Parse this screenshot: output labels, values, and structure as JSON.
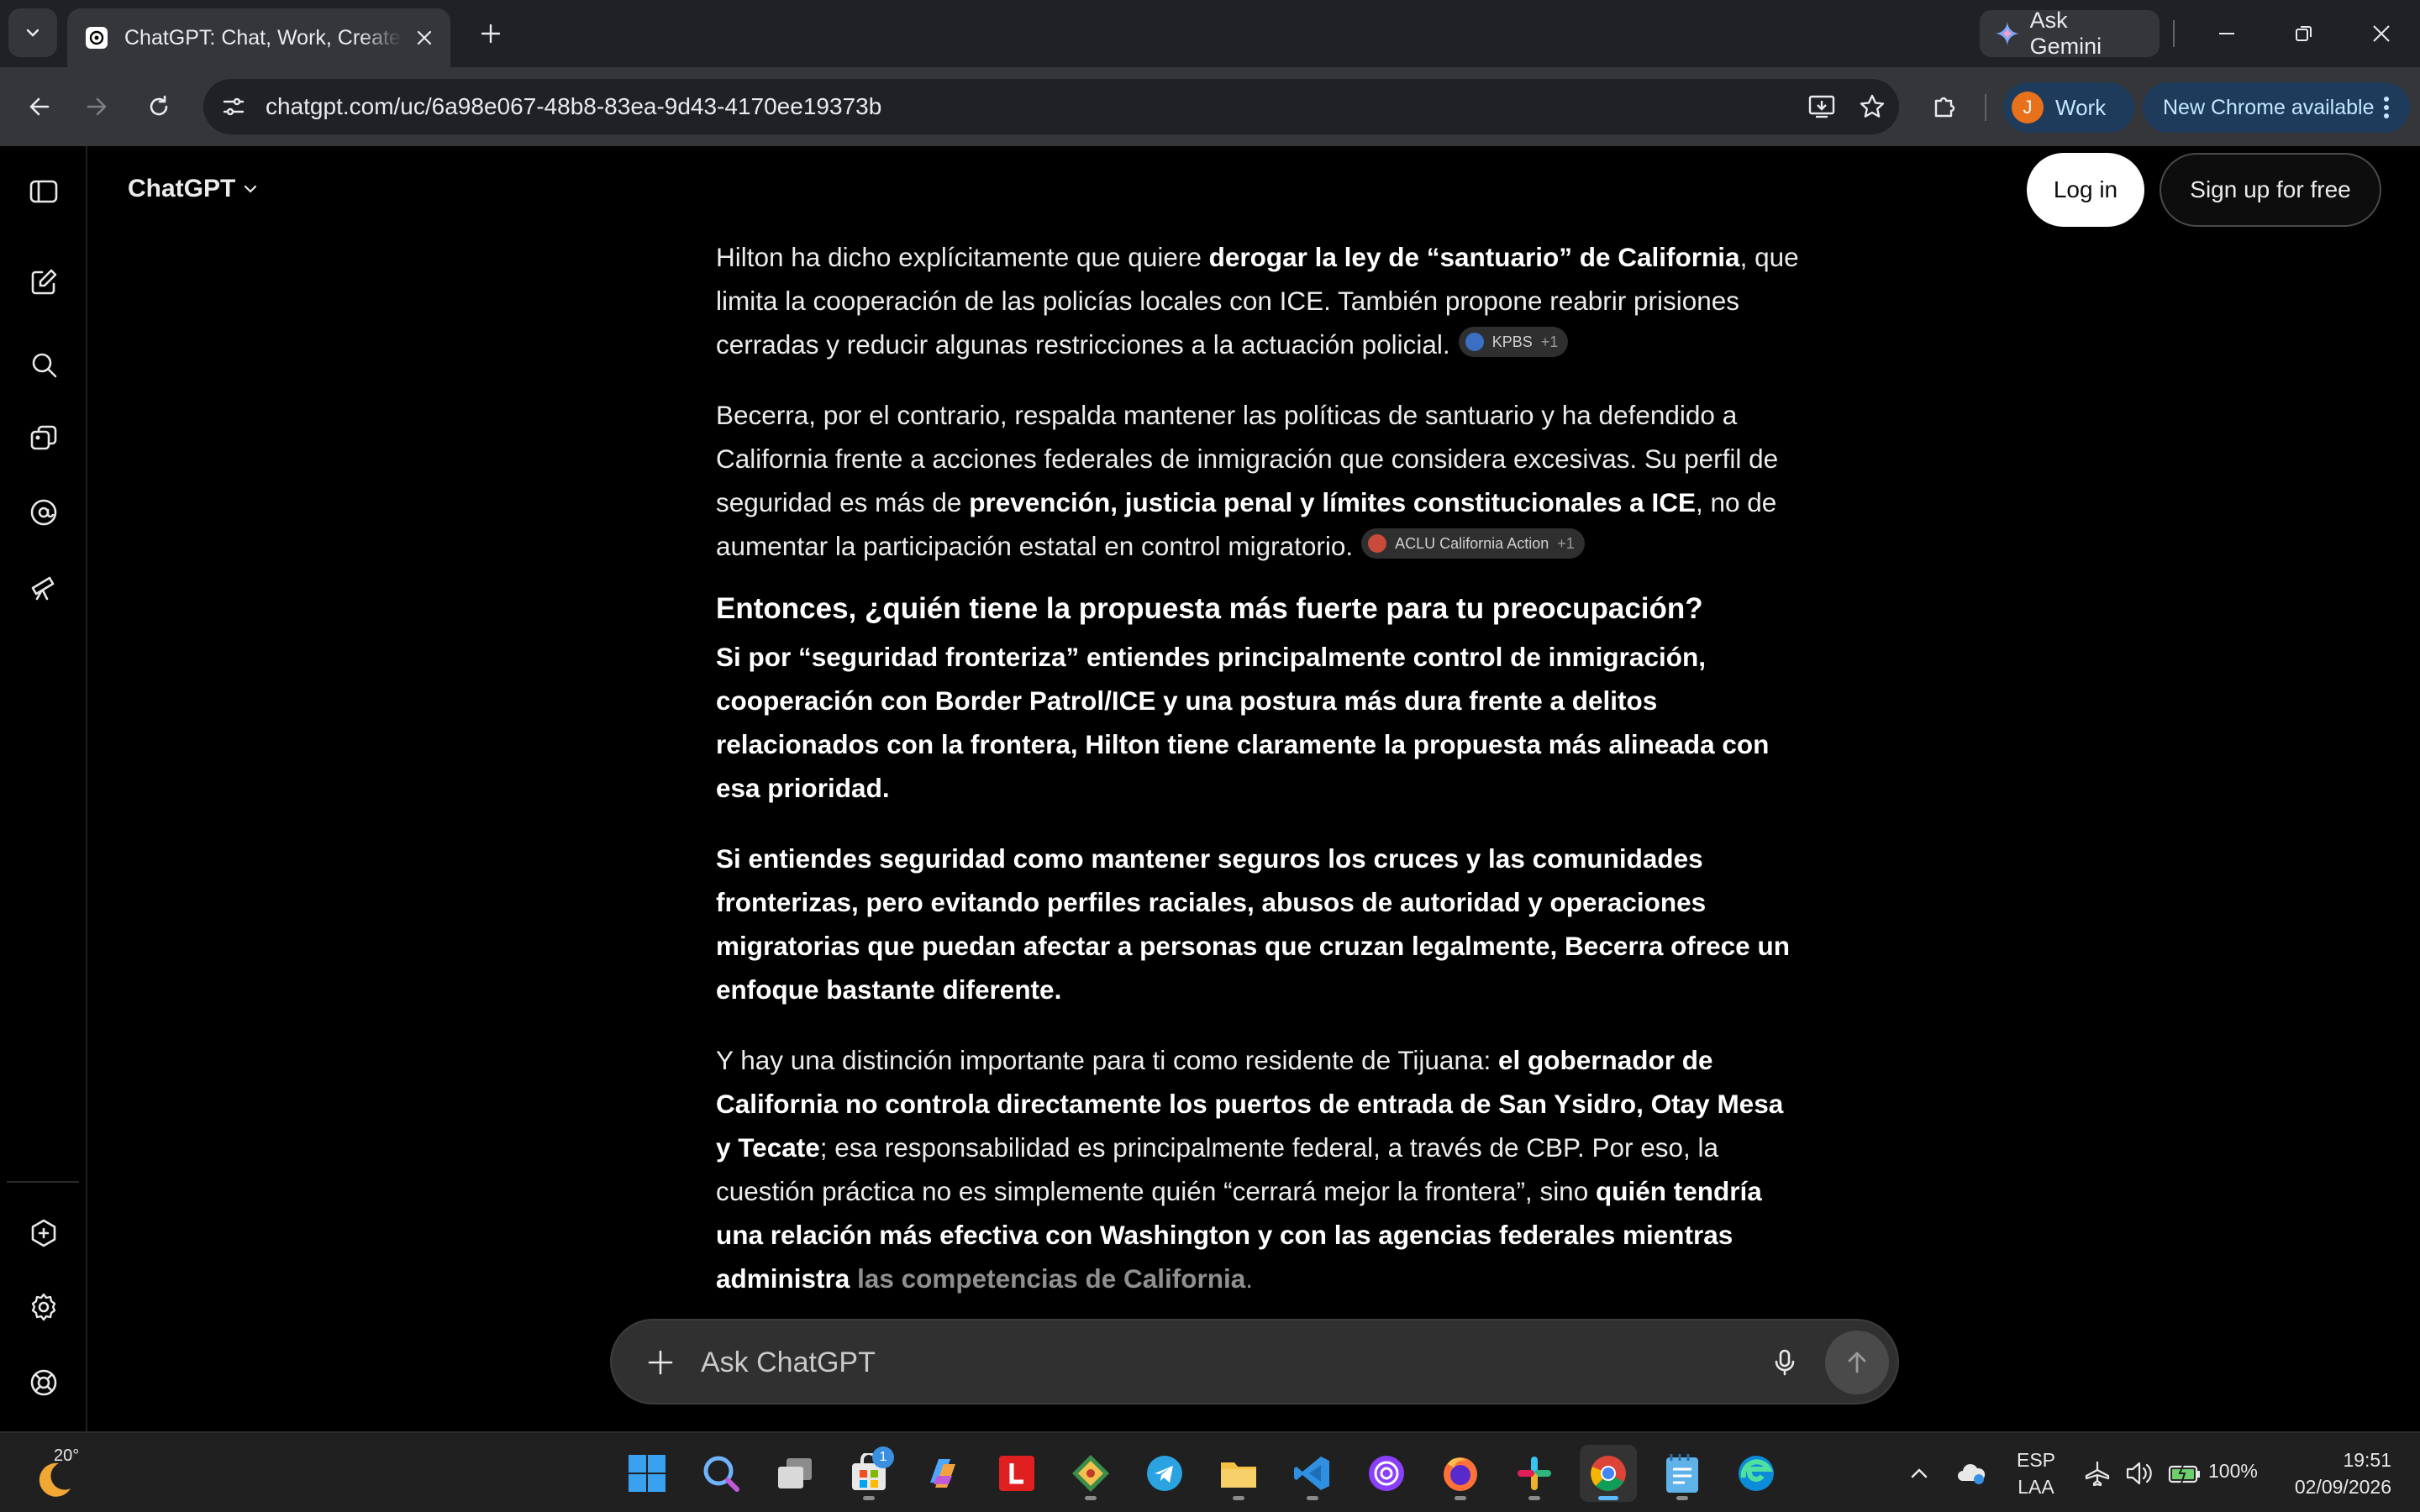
{
  "browser": {
    "tab_title": "ChatGPT: Chat, Work, Create & Learn",
    "ask_gemini": "Ask Gemini",
    "url": "chatgpt.com/uc/6a98e067-48b8-83ea-9d43-4170ee19373b",
    "profile_initial": "J",
    "profile_label": "Work",
    "update_label": "New Chrome available"
  },
  "app": {
    "brand": "ChatGPT",
    "login": "Log in",
    "signup": "Sign up for free"
  },
  "message": {
    "p1": {
      "t1": "Hilton ha dicho explícitamente que quiere ",
      "b1": "derogar la ley de “santuario” de California",
      "t2": ", que limita la cooperación de las policías locales con ICE. También propone reabrir prisiones cerradas y reducir algunas restricciones a la actuación policial.",
      "cite": "KPBS",
      "cite_more": "+1"
    },
    "p2": {
      "t1": "Becerra, por el contrario, respalda mantener las políticas de santuario y ha defendido a California frente a acciones federales de inmigración que considera excesivas. Su perfil de seguridad es más de ",
      "b1": "prevención, justicia penal y límites constitucionales a ICE",
      "t2": ", no de aumentar la participación estatal en control migratorio.",
      "cite": "ACLU California Action",
      "cite_more": "+1"
    },
    "heading": "Entonces, ¿quién tiene la propuesta más fuerte para tu preocupación?",
    "p3": "Si por “seguridad fronteriza” entiendes principalmente control de inmigración, cooperación con Border Patrol/ICE y una postura más dura frente a delitos relacionados con la frontera, Hilton tiene claramente la propuesta más alineada con esa prioridad.",
    "p4": "Si entiendes seguridad como mantener seguros los cruces y las comunidades fronterizas, pero evitando perfiles raciales, abusos de autoridad y operaciones migratorias que puedan afectar a personas que cruzan legalmente, Becerra ofrece un enfoque bastante diferente.",
    "p5": {
      "t1": "Y hay una distinción importante para ti como residente de Tijuana: ",
      "b1": "el gobernador de California no controla directamente los puertos de entrada de San Ysidro, Otay Mesa y Tecate",
      "t2": "; esa responsabilidad es principalmente federal, a través de CBP. Por eso, la cuestión práctica no es simplemente quién “cerrará mejor la frontera”, sino ",
      "b2": "quién tendría una relación más efectiva con Washington y con las agencias federales mientras administra",
      "b3": "las competencias de California",
      "t3": "."
    }
  },
  "composer": {
    "placeholder": "Ask ChatGPT"
  },
  "taskbar": {
    "weather_temp": "20°",
    "store_badge": "1",
    "lang_line1": "ESP",
    "lang_line2": "LAA",
    "battery": "100%",
    "time": "19:51",
    "date": "02/09/2026"
  },
  "colors": {
    "accent_chrome": "#1f3b5c",
    "page_bg": "#000000",
    "composer_bg": "#303030"
  }
}
